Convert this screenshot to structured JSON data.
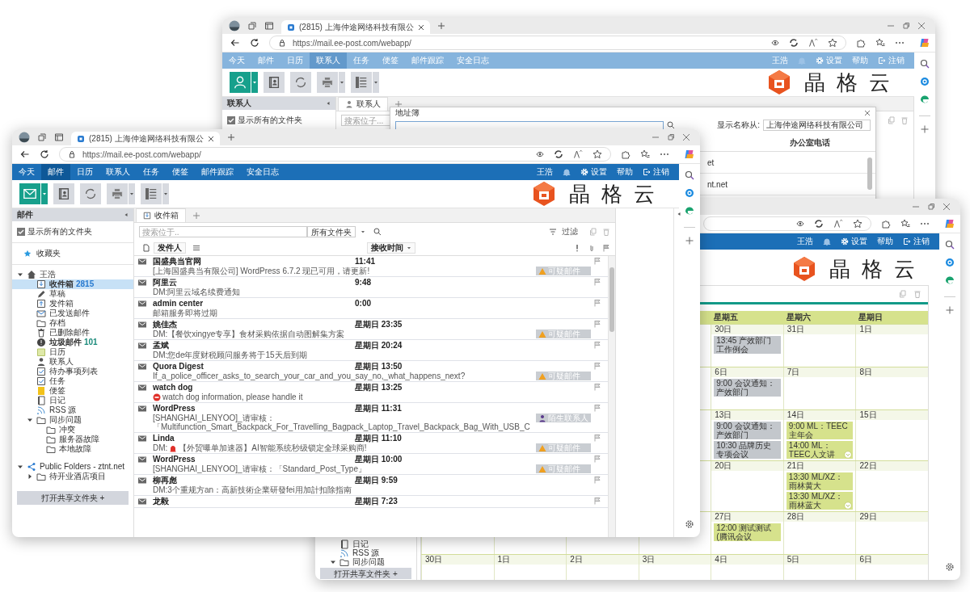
{
  "windows": [
    {
      "kind": "contacts",
      "tab_title": "(2815) 上海仲途网络科技有限公",
      "url": "https://mail.ee-post.com/webapp/",
      "nav": {
        "items": [
          {
            "label": "今天",
            "selected": false
          },
          {
            "label": "邮件",
            "selected": false
          },
          {
            "label": "日历",
            "selected": false
          },
          {
            "label": "联系人",
            "selected": true
          },
          {
            "label": "任务",
            "selected": false
          },
          {
            "label": "便签",
            "selected": false
          },
          {
            "label": "邮件跟踪",
            "selected": false
          },
          {
            "label": "安全日志",
            "selected": false
          }
        ],
        "user": "王浩",
        "settings": "设置",
        "help": "帮助",
        "logout": "注销"
      },
      "logo_text": "晶格云",
      "sidebar": {
        "title": "联系人",
        "show_all": {
          "label": "显示所有的文件夹",
          "checked": true
        }
      },
      "tab": "联系人",
      "search_placeholder": "搜索位子...",
      "dialog": {
        "title": "地址簿",
        "display_label": "显示名称从:",
        "display_value": "上海仲途网络科技有限公司",
        "column": "办公室电话",
        "rows": [
          "et",
          "nt.net"
        ]
      }
    },
    {
      "kind": "calendar",
      "nav": {
        "user": "王浩",
        "settings": "设置",
        "help": "帮助",
        "logout": "注销"
      },
      "logo_text": "晶格云",
      "sidebar": {
        "items": [
          {
            "label": "日记",
            "kind": "journal",
            "selected": false
          },
          {
            "label": "RSS 源",
            "kind": "rss",
            "selected": false
          },
          {
            "label": "同步问题",
            "kind": "folder",
            "expanded": true,
            "selected": false
          }
        ],
        "button": "打开共享文件夹 +"
      },
      "weekdays": [
        "星期五",
        "星期六",
        "星期日"
      ],
      "weeks": [
        {
          "days": [
            {
              "date": "30日",
              "more": false,
              "events": [
                {
                  "text": "13:45 产效部门工作例会",
                  "color": "#c3c7cc"
                }
              ]
            },
            {
              "date": "31日",
              "more": false
            },
            {
              "date": "1日",
              "more": false
            }
          ]
        },
        {
          "days": [
            {
              "date": "6日",
              "more": false,
              "events": [
                {
                  "text": "9:00 会议通知：产效部门",
                  "color": "#c3c7cc"
                }
              ]
            },
            {
              "date": "7日",
              "more": false
            },
            {
              "date": "8日",
              "more": false
            }
          ]
        },
        {
          "days": [
            {
              "date": "13日",
              "more": false,
              "events": [
                {
                  "text": "9:00 会议通知：产效部门",
                  "color": "#c3c7cc"
                },
                {
                  "text": "10:30 品牌历史专项会议",
                  "color": "#c3c7cc"
                }
              ]
            },
            {
              "date": "14日",
              "more": true,
              "events": [
                {
                  "text": "9:00 ML：TEEC主年会",
                  "color": "#d6e28c"
                },
                {
                  "text": "14:00 ML：TEEC人文讲",
                  "color": "#d6e28c"
                }
              ]
            },
            {
              "date": "15日",
              "more": false
            }
          ]
        },
        {
          "days": [
            {
              "date": "20日",
              "more": false
            },
            {
              "date": "21日",
              "more": true,
              "events": [
                {
                  "text": "13:30 ML/XZ：雨林黄大",
                  "color": "#d6e28c"
                },
                {
                  "text": "13:30 ML/XZ：雨林蓝大",
                  "color": "#d6e28c"
                }
              ]
            },
            {
              "date": "22日",
              "more": false
            }
          ]
        },
        {
          "days": [
            {
              "date": "27日",
              "more": false,
              "events": [
                {
                  "text": "12:00 测试测试 (腾讯会议",
                  "color": "#d6e28c"
                }
              ]
            },
            {
              "date": "28日",
              "more": false
            },
            {
              "date": "29日",
              "more": false
            }
          ]
        },
        {
          "days": [
            {
              "date": "30日",
              "more": false
            },
            {
              "date": "1日",
              "more": false
            },
            {
              "date": "2日",
              "more": false
            },
            {
              "date": "3日",
              "more": false
            },
            {
              "date": "4日",
              "more": false
            },
            {
              "date": "5日",
              "more": false
            },
            {
              "date": "6日",
              "more": false
            }
          ]
        }
      ]
    },
    {
      "kind": "mail",
      "tab_title": "(2815) 上海仲途网络科技有限公",
      "url": "https://mail.ee-post.com/webapp/",
      "nav": {
        "items": [
          {
            "label": "今天",
            "selected": false
          },
          {
            "label": "邮件",
            "selected": true
          },
          {
            "label": "日历",
            "selected": false
          },
          {
            "label": "联系人",
            "selected": false
          },
          {
            "label": "任务",
            "selected": false
          },
          {
            "label": "便签",
            "selected": false
          },
          {
            "label": "邮件跟踪",
            "selected": false
          },
          {
            "label": "安全日志",
            "selected": false
          }
        ],
        "user": "王浩",
        "settings": "设置",
        "help": "帮助",
        "logout": "注销"
      },
      "logo_text": "晶格云",
      "sidebar": {
        "title": "邮件",
        "show_all": {
          "label": "显示所有的文件夹",
          "checked": true
        },
        "favorites": "收藏夹",
        "tree": [
          {
            "label": "王浩",
            "kind": "home",
            "expanded": true,
            "selected": false,
            "children": [
              {
                "label": "收件箱",
                "kind": "inbox",
                "count": "2815",
                "selected": true
              },
              {
                "label": "草稿",
                "kind": "draft",
                "selected": false
              },
              {
                "label": "发件箱",
                "kind": "outbox",
                "selected": false
              },
              {
                "label": "已发送邮件",
                "kind": "sent",
                "selected": false
              },
              {
                "label": "存档",
                "kind": "folder",
                "selected": false
              },
              {
                "label": "已删除邮件",
                "kind": "trash",
                "selected": false
              },
              {
                "label": "垃圾邮件",
                "kind": "junk",
                "count": "101",
                "selected": false
              },
              {
                "label": "日历",
                "kind": "calendar",
                "selected": false
              },
              {
                "label": "联系人",
                "kind": "contacts",
                "selected": false
              },
              {
                "label": "待办事项列表",
                "kind": "todo",
                "selected": false
              },
              {
                "label": "任务",
                "kind": "task",
                "selected": false
              },
              {
                "label": "便签",
                "kind": "note",
                "selected": false
              },
              {
                "label": "日记",
                "kind": "journal",
                "selected": false
              },
              {
                "label": "RSS 源",
                "kind": "rss",
                "selected": false
              },
              {
                "label": "同步问题",
                "kind": "folder",
                "expanded": true,
                "selected": false,
                "children": [
                  {
                    "label": "冲突",
                    "kind": "folder",
                    "selected": false
                  },
                  {
                    "label": "服务器故障",
                    "kind": "folder",
                    "selected": false
                  },
                  {
                    "label": "本地故障",
                    "kind": "folder",
                    "selected": false
                  }
                ]
              }
            ]
          },
          {
            "label": "Public Folders - ztnt.net",
            "kind": "share",
            "expanded": true,
            "selected": false,
            "children": [
              {
                "label": "待开业酒店项目",
                "kind": "folder",
                "expanded": false,
                "selected": false
              }
            ]
          }
        ],
        "button": "打开共享文件夹 +"
      },
      "tab": "收件箱",
      "search_placeholder": "搜索位于..",
      "folder_filter": "所有文件夹",
      "filter": "过滤",
      "columns": [
        "发件人",
        "接收时间"
      ],
      "messages": [
        {
          "sender": "国盛典当官网",
          "time": "11:41",
          "subject": "[上海国盛典当有限公司] WordPress 6.7.2 现已可用，请更新!",
          "tag": {
            "kind": "suspicious",
            "label": "可疑邮件"
          }
        },
        {
          "sender": "阿里云",
          "time": "9:48",
          "subject": "DM:阿里云域名续费通知"
        },
        {
          "sender": "admin center",
          "time": "0:00",
          "subject": "邮箱服务即将过期"
        },
        {
          "sender": "姚佳杰",
          "time": "星期日 23:35",
          "subject": "DM:【餐饮xingye专享】食材采购依据自动图解集方案",
          "tag": {
            "kind": "suspicious",
            "label": "可疑邮件"
          }
        },
        {
          "sender": "孟斌",
          "time": "星期日 20:24",
          "subject": "DM:您de年度财税顾问服务将于15天后到期"
        },
        {
          "sender": "Quora Digest",
          "time": "星期日 13:50",
          "subject": "If_a_police_officer_asks_to_search_your_car_and_you_say_no,_what_happens_next?",
          "tag": {
            "kind": "suspicious",
            "label": "可疑邮件"
          }
        },
        {
          "sender": "watch dog",
          "time": "星期日 13:25",
          "subject": "watch dog information, please handle it",
          "subject_icon": {
            "kind": "stop"
          }
        },
        {
          "sender": "WordPress",
          "time": "星期日 11:31",
          "subject": "[SHANGHAI_LENYOO]_请审核：「Multifunction_Smart_Backpack_For_Travelling_Bagpack_Laptop_Travel_Backpack_Bag_With_USB_C",
          "tag": {
            "kind": "stranger",
            "label": "陌生联系人"
          }
        },
        {
          "sender": "Linda",
          "time": "星期日 11:10",
          "subject": "【外贸曝单加速器】AI智能系统秒级锁定全球采购商!",
          "subject_prefix": "DM:",
          "subject_icon": {
            "kind": "siren"
          },
          "tag": {
            "kind": "suspicious",
            "label": "可疑邮件"
          }
        },
        {
          "sender": "WordPress",
          "time": "星期日 10:00",
          "subject": "[SHANGHAI_LENYOO]_请审核：「Standard_Post_Type」",
          "tag": {
            "kind": "suspicious",
            "label": "可疑邮件"
          }
        },
        {
          "sender": "柳再彪",
          "time": "星期日 9:59",
          "subject": "DM:3个重规方an：高新技術企業研發fei用加計扣除指南"
        },
        {
          "sender": "龙毅",
          "time": "星期日 7:23"
        }
      ]
    }
  ]
}
